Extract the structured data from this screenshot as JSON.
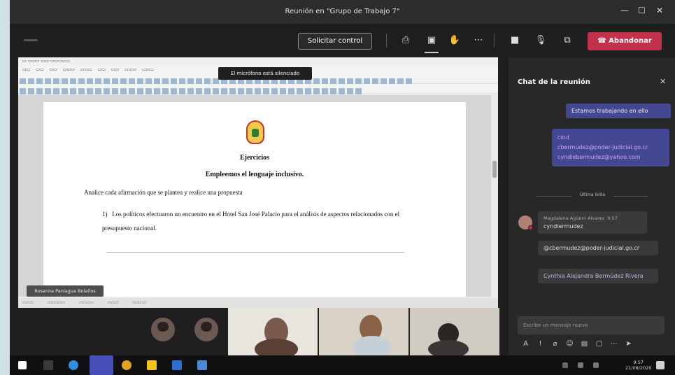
{
  "window": {
    "title": "Reunión en \"Grupo de Trabajo 7\""
  },
  "toolbar": {
    "request_control_label": "Solicitar control",
    "leave_label": "Abandonar",
    "icons": [
      "share-tray-icon",
      "chat-icon",
      "raise-hand-icon",
      "more-icon",
      "camera-icon",
      "mic-icon",
      "share-screen-icon"
    ]
  },
  "shared_screen": {
    "mic_tooltip": "El micrófono está silenciado",
    "document": {
      "title": "Ejercicios",
      "subtitle": "Empleemos el lenguaje inclusivo.",
      "intro": "Analice cada afirmación que se plantea y realice una propuesta",
      "item_number": "1)",
      "item_text": "Los políticos efectuaron un encuentro en el Hotel San José Palacio para el análisis de aspectos relacionados con el presupuesto nacional."
    },
    "sharer_name": "Rosanna Paniagua Bolaños"
  },
  "chat": {
    "title": "Chat de la reunión",
    "messages_sent": [
      {
        "text": "Estamos trabajando en ello"
      },
      {
        "lines": [
          "cbermudez@poder-judicial.go.cr",
          "cyndiebermudez@yahoo.com"
        ],
        "prefix": "cind"
      }
    ],
    "divider_label": "Última leída",
    "messages_received": [
      {
        "sender": "Magdalena Agüero Alvarez",
        "time": "9:57",
        "text": "cyndiermudez"
      },
      {
        "text": "@cbermudez@poder-judicial.go.cr"
      },
      {
        "text": "Cynthia Alejandra Bermúdez Rivera"
      }
    ],
    "compose_placeholder": "Escribe un mensaje nuevo"
  },
  "taskbar": {
    "time": "9:57",
    "date": "21/08/2020"
  },
  "colors": {
    "accent_purple": "#444791",
    "leave_red": "#c4314b",
    "chrome_dark": "#201f1f"
  }
}
